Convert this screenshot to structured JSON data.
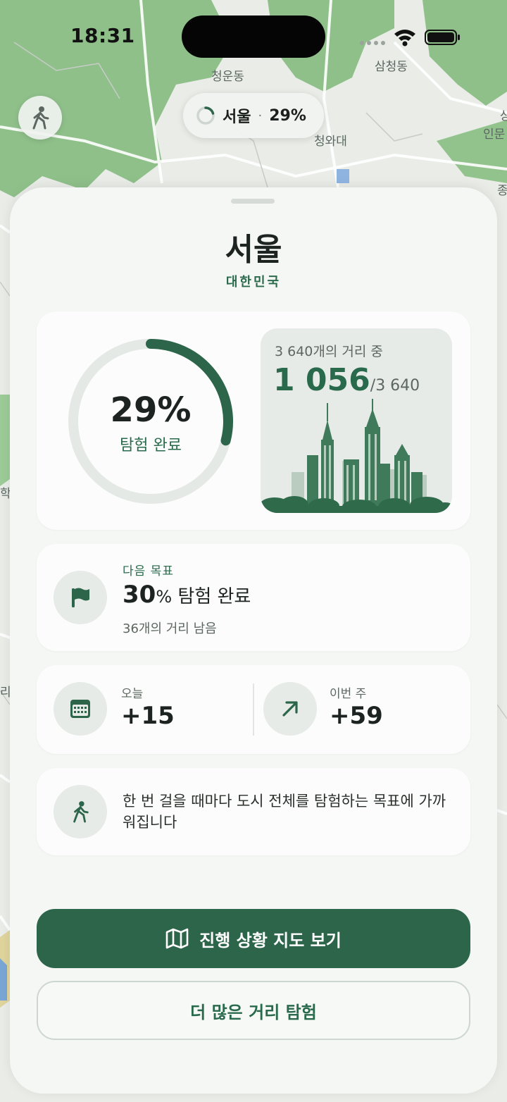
{
  "status_bar": {
    "time": "18:31"
  },
  "map": {
    "labels": {
      "cheongundong": "청운동",
      "samcheongdong": "삼청동",
      "cheongwadae": "청와대",
      "inmun": "인문",
      "edge_sang": "상",
      "edge_hak": "학",
      "edge_ri": "리",
      "edge_jong": "종"
    }
  },
  "city_pill": {
    "name": "서울",
    "separator": "·",
    "percent": "29%"
  },
  "sheet": {
    "title": "서울",
    "country": "대한민국",
    "progress": {
      "percent_text": "29%",
      "fraction": 0.29,
      "label": "탐험 완료",
      "streets_caption": "3 640개의 거리 중",
      "explored": "1 056",
      "total": "/3 640"
    },
    "next_goal": {
      "caption": "다음 목표",
      "percent_number": "30",
      "percent_unit": "%",
      "title_rest": " 탐험 완료",
      "remaining": "36개의 거리 남음"
    },
    "stats": {
      "today_label": "오늘",
      "today_value": "+15",
      "week_label": "이번 주",
      "week_value": "+59"
    },
    "motivation": "한 번 걸을 때마다 도시 전체를 탐험하는 목표에 가까워집니다",
    "buttons": {
      "primary": "진행 상황 지도 보기",
      "secondary": "더 많은 거리 탐험"
    }
  },
  "colors": {
    "accent": "#2c654a",
    "accent_text": "#2a6a4c",
    "ring_track": "#e4e9e6",
    "map_green": "#8fc08a"
  },
  "icons": [
    "walking-icon",
    "spinner-icon",
    "flag-icon",
    "calendar-icon",
    "arrow-up-right-icon",
    "map-icon"
  ]
}
